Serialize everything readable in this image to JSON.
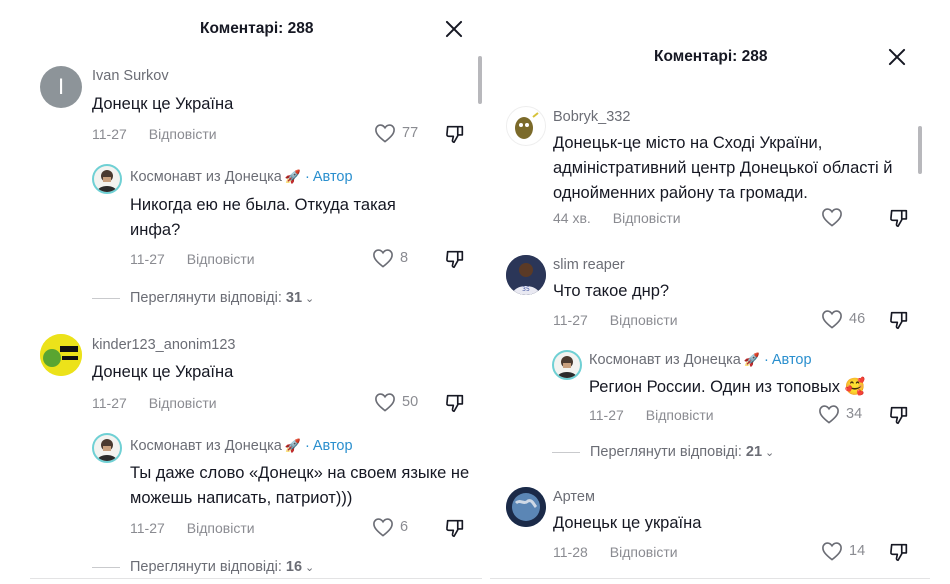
{
  "left": {
    "header_title": "Коментарі: 288",
    "reply_label": "Відповісти",
    "comments": [
      {
        "user": "Ivan Surkov",
        "avatar_letter": "I",
        "text": "Донецк це Україна",
        "date": "11-27",
        "likes": "77"
      },
      {
        "user": "Космонавт из Донецка",
        "author_tag": "Автор",
        "text": "Никогда ею не была. Откуда такая инфа?",
        "date": "11-27",
        "likes": "8"
      },
      {
        "user": "kinder123_anonim123",
        "text": "Донецк це Україна",
        "date": "11-27",
        "likes": "50"
      },
      {
        "user": "Космонавт из Донецка",
        "author_tag": "Автор",
        "text": "Ты даже слово «Донецк» на своем языке не можешь написать, патриот)))",
        "date": "11-27",
        "likes": "6"
      }
    ],
    "view_replies": [
      {
        "label": "Переглянути відповіді:",
        "count": "31"
      },
      {
        "label": "Переглянути відповіді:",
        "count": "16"
      }
    ]
  },
  "right": {
    "header_title": "Коментарі: 288",
    "reply_label": "Відповісти",
    "comments": [
      {
        "user": "Bobryk_332",
        "text": "Донецьк-це місто на Сході України, адміністративний центр Донецької області й однойменних району та громади.",
        "date": "44 хв.",
        "likes": ""
      },
      {
        "user": "slim reaper",
        "text": "Что такое днр?",
        "date": "11-27",
        "likes": "46"
      },
      {
        "user": "Космонавт из Донецка",
        "author_tag": "Автор",
        "text": "Регион России. Один из топовых 🥰",
        "date": "11-27",
        "likes": "34"
      },
      {
        "user": "Артем",
        "text": "Донецьк це україна",
        "date": "11-28",
        "likes": "14"
      }
    ],
    "view_replies": [
      {
        "label": "Переглянути відповіді:",
        "count": "21"
      }
    ]
  },
  "colors": {
    "author": "#2a8fce",
    "muted": "#8a8b91",
    "text": "#161823"
  }
}
